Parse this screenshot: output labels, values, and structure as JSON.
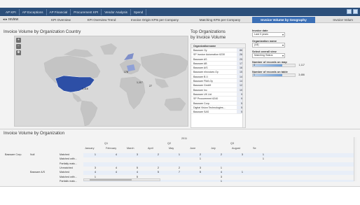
{
  "topnav": {
    "tabs": [
      {
        "label": "AP KPI",
        "active": true
      },
      {
        "label": "AP Exceptions",
        "active": false
      },
      {
        "label": "AP Financial",
        "active": false
      },
      {
        "label": "Procurement KPI",
        "active": false
      },
      {
        "label": "Vendor Analysis",
        "active": false
      },
      {
        "label": "Spend",
        "active": false
      }
    ]
  },
  "subtabs": {
    "nav": "◂ ▸  review",
    "items": [
      {
        "label": "KPI Overview",
        "active": false
      },
      {
        "label": "KPI Overview Trend",
        "active": false
      },
      {
        "label": "Invoice Origin KPIs per Company",
        "active": false
      },
      {
        "label": "Matching KPIs per Company",
        "active": false
      },
      {
        "label": "Invoice Volume by Geography",
        "active": true
      },
      {
        "label": "Invoice Volum",
        "active": false
      }
    ]
  },
  "map_panel": {
    "title": "Invoice Volume by Organization Country",
    "labels": [
      "1,116",
      "178",
      "1,117",
      "27"
    ]
  },
  "top_orgs": {
    "title_line1": "Top Organizations",
    "title_line2": "by Invoice Volume",
    "column_header": "Organizationname",
    "rows": [
      {
        "name": "Basware Oy",
        "value": "865"
      },
      {
        "name": "SP Invoice Automation 6230",
        "value": "266"
      },
      {
        "name": "Basware AS",
        "value": "255"
      },
      {
        "name": "Basware AB",
        "value": "172"
      },
      {
        "name": "Basware A/S",
        "value": "164"
      },
      {
        "name": "Basware eInvoices Oy",
        "value": "158"
      },
      {
        "name": "Basware B.V.",
        "value": "144"
      },
      {
        "name": "Basware FMA Oy",
        "value": "144"
      },
      {
        "name": "Basware GmbH",
        "value": "128"
      },
      {
        "name": "Basware Inc",
        "value": "100"
      },
      {
        "name": "Basware UK Ltd",
        "value": "99"
      },
      {
        "name": "SP Procurement 6240",
        "value": "90"
      },
      {
        "name": "Basware Corp.",
        "value": "57"
      },
      {
        "name": "Digital Vision Technologies...",
        "value": "53"
      },
      {
        "name": "Basware SAS",
        "value": "53"
      }
    ]
  },
  "filters": {
    "invoice_date_label": "Invoice date",
    "invoice_date_value": "Last 3 years",
    "org_name_label": "Organization name",
    "org_name_value": "(All)",
    "overall_view_label": "Select overall view",
    "overall_view_value": "Matching Status",
    "records_map_label": "Number of records on map",
    "records_map_lo": "4",
    "records_map_hi": "1,117",
    "records_table_label": "Number of records on table",
    "records_table_lo": "1",
    "records_table_hi": "3,486"
  },
  "pivot": {
    "title": "Invoice Volume by Organization",
    "year": "2011",
    "quarters": [
      "Q1",
      "Q2",
      "Q3"
    ],
    "months": [
      "January",
      "February",
      "March",
      "April",
      "May",
      "June",
      "July",
      "August",
      "Se"
    ],
    "rows": [
      {
        "company": "Basware Corp.",
        "org": "Null",
        "status": "Matched",
        "values": [
          "1",
          "4",
          "3",
          "2",
          "1",
          "2",
          "2",
          "3",
          "1"
        ]
      },
      {
        "company": "",
        "org": "",
        "status": "Matched with...",
        "values": [
          "",
          "",
          "",
          "",
          "",
          "1",
          "",
          "",
          "1"
        ]
      },
      {
        "company": "",
        "org": "",
        "status": "Partially matc...",
        "values": [
          "",
          "",
          "",
          "",
          "",
          "",
          "",
          "",
          ""
        ]
      },
      {
        "company": "",
        "org": "",
        "status": "Unmatched",
        "values": [
          "3",
          "4",
          "5",
          "2",
          "2",
          "3",
          "1",
          "",
          ""
        ]
      },
      {
        "company": "",
        "org": "Basware A/S",
        "status": "Matched",
        "values": [
          "4",
          "4",
          "4",
          "5",
          "7",
          "5",
          "4",
          "1",
          ""
        ]
      },
      {
        "company": "",
        "org": "",
        "status": "Matched with...",
        "values": [
          "1",
          "",
          "5",
          "",
          "",
          "",
          "3",
          "",
          ""
        ]
      },
      {
        "company": "",
        "org": "",
        "status": "Partially matc...",
        "values": [
          "",
          "",
          "",
          "",
          "",
          "",
          "1",
          "",
          ""
        ]
      },
      {
        "company": "",
        "org": "",
        "status": "Unmatched",
        "values": [
          "",
          "",
          "",
          "",
          "",
          "",
          "",
          "",
          ""
        ]
      }
    ]
  }
}
